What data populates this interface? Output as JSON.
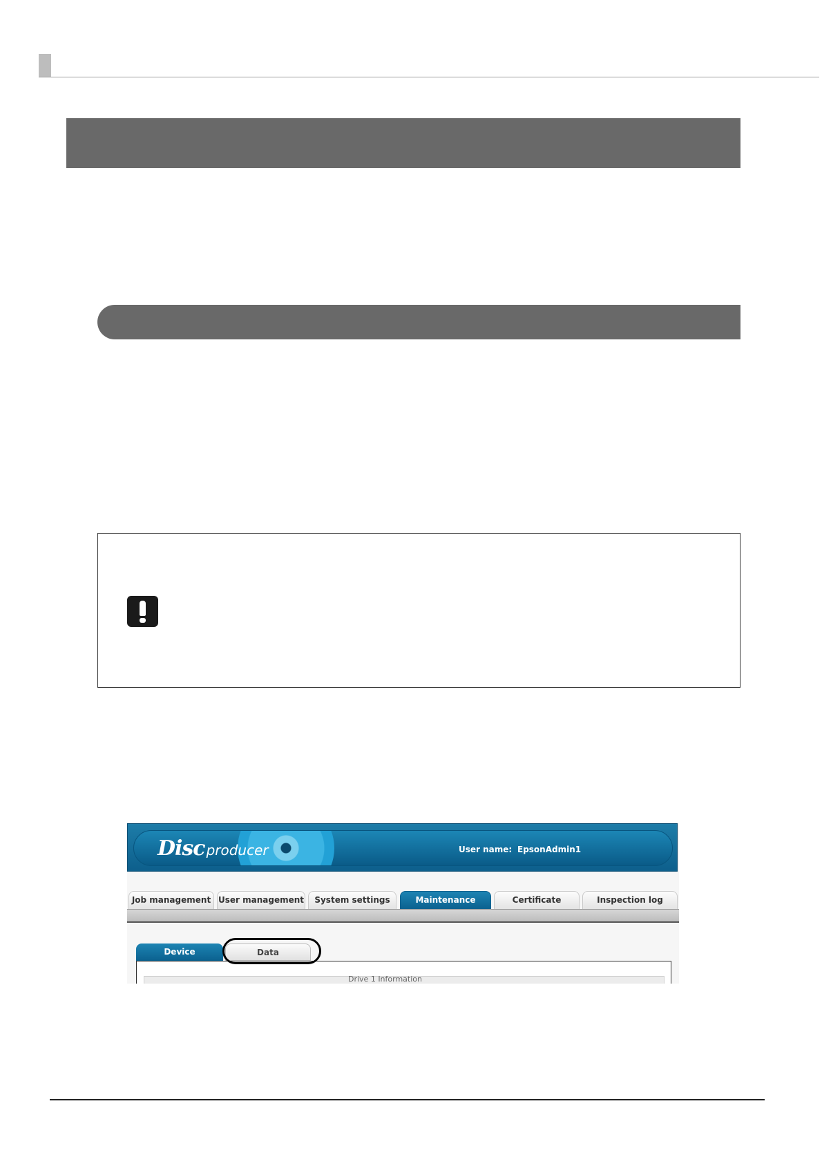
{
  "app": {
    "logo_disc": "Disc",
    "logo_producer": "producer",
    "user_name_label": "User name:",
    "user_name_value": "EpsonAdmin1"
  },
  "main_tabs": [
    {
      "label": "Job management"
    },
    {
      "label": "User management"
    },
    {
      "label": "System settings"
    },
    {
      "label": "Maintenance",
      "active": true
    },
    {
      "label": "Certificate"
    },
    {
      "label": "Inspection log"
    }
  ],
  "sub_tabs": [
    {
      "label": "Device",
      "active": true
    },
    {
      "label": "Data"
    }
  ],
  "inner_panel_title": "Drive 1 Information",
  "colors": {
    "accent": "#0b618f",
    "section_bar": "#696969"
  },
  "icons": {
    "note": "important-icon"
  }
}
